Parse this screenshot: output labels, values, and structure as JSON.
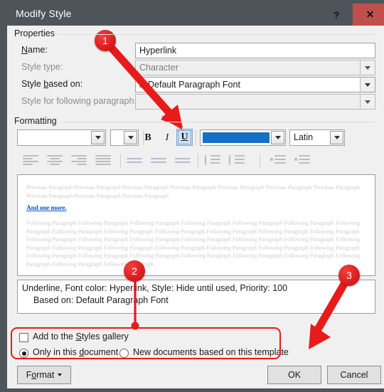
{
  "window": {
    "title": "Modify Style",
    "help_label": "?",
    "close_label": "✕"
  },
  "properties": {
    "group_label": "Properties",
    "name_label": "Name:",
    "name_value": "Hyperlink",
    "style_type_label": "Style type:",
    "style_type_value": "Character",
    "style_based_on_label": "Style based on:",
    "style_based_on_value": "Default Paragraph Font",
    "style_based_on_icon": "a",
    "style_following_label": "Style for following paragraph:",
    "style_following_value": ""
  },
  "formatting": {
    "group_label": "Formatting",
    "font_name_value": "",
    "font_size_value": "",
    "bold_label": "B",
    "italic_label": "I",
    "underline_label": "U",
    "font_color_hex": "#1271c6",
    "script_value": "Latin",
    "align_icons": [
      "align-left-icon",
      "align-center-icon",
      "align-right-icon",
      "align-justify-icon",
      "line-spacing-single-icon",
      "line-spacing-1-5-icon",
      "line-spacing-double-icon",
      "space-before-icon",
      "space-after-icon",
      "decrease-indent-icon",
      "increase-indent-icon"
    ]
  },
  "preview": {
    "previous_paragraph": "Previous Paragraph Previous Paragraph Previous Paragraph Previous Paragraph Previous Paragraph Previous Paragraph Previous Paragraph Previous Paragraph Previous Paragraph Previous Paragraph",
    "sample_link": "And one more.",
    "following_paragraph": "Following Paragraph Following Paragraph Following Paragraph Following Paragraph Following Paragraph Following Paragraph Following Paragraph Following Paragraph Following Paragraph Following Paragraph Following Paragraph Following Paragraph Following Paragraph Following Paragraph Following Paragraph Following Paragraph Following Paragraph Following Paragraph Following Paragraph Following Paragraph Following Paragraph Following Paragraph Following Paragraph Following Paragraph Following Paragraph Following Paragraph Following Paragraph Following Paragraph Following Paragraph Following Paragraph Following Paragraph Following Paragraph Following Paragraph Following Paragraph Following Paragraph"
  },
  "description": {
    "line1": "Underline, Font color: Hyperlink, Style: Hide until used, Priority: 100",
    "line2": "Based on: Default Paragraph Font"
  },
  "options": {
    "add_to_gallery_label": "Add to the Styles gallery",
    "add_to_gallery_checked": false,
    "only_document_label": "Only in this document",
    "only_document_selected": true,
    "new_documents_label": "New documents based on this template",
    "new_documents_selected": false
  },
  "buttons": {
    "format_label": "Format",
    "ok_label": "OK",
    "cancel_label": "Cancel"
  },
  "annotations": {
    "callout_1": "1",
    "callout_2": "2",
    "callout_3": "3",
    "marker_color": "#e81b1b"
  }
}
